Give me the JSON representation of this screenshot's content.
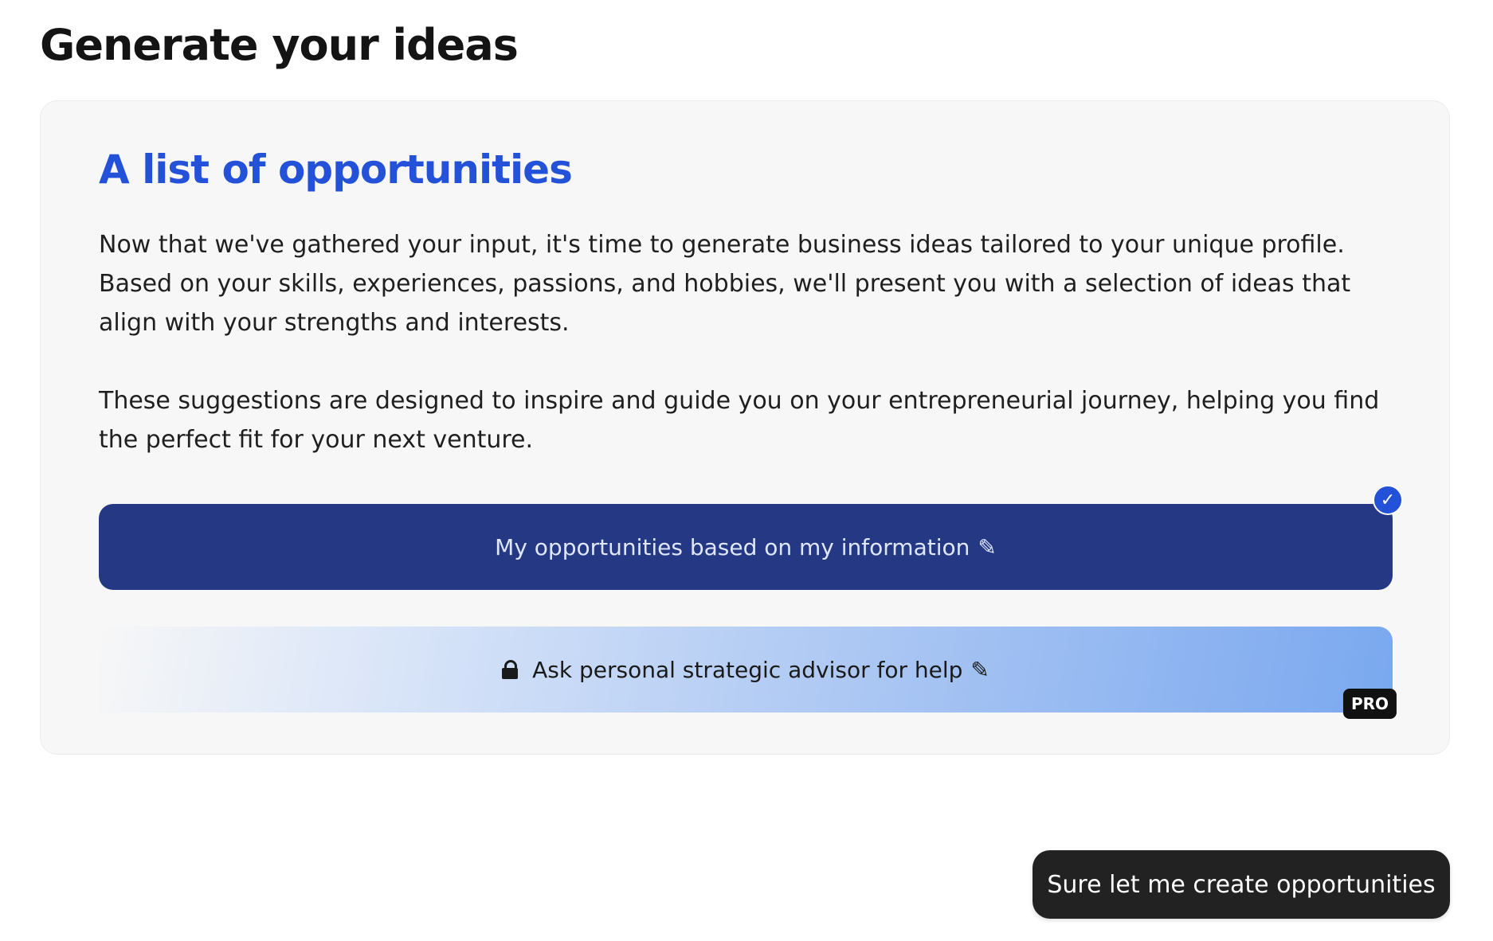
{
  "page": {
    "title": "Generate your ideas"
  },
  "card": {
    "title": "A list of opportunities",
    "paragraphs": [
      "Now that we've gathered your input, it's time to generate business ideas tailored to your unique profile. Based on your skills, experiences, passions, and hobbies, we'll present you with a selection of ideas that align with your strengths and interests.",
      "These suggestions are designed to inspire and guide you on your entrepreneurial journey, helping you find the perfect fit for your next venture."
    ],
    "options": [
      {
        "label": "My opportunities based on my information",
        "trailing_icon": "pencil-icon",
        "selected": true,
        "badge_icon": "checkmark-icon"
      },
      {
        "label": "Ask personal strategic advisor for help",
        "leading_icon": "lock-icon",
        "trailing_icon": "pencil-icon",
        "locked": true,
        "badge": "PRO"
      }
    ]
  },
  "cta": {
    "label": "Sure let me create opportunities"
  },
  "colors": {
    "accent": "#2352d8",
    "primary_option_bg": "#253884",
    "cta_bg": "#222222"
  },
  "glyphs": {
    "pencil": "✎",
    "check": "✓"
  }
}
